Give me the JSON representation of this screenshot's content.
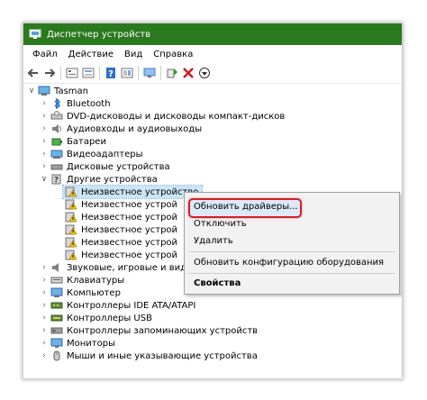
{
  "window": {
    "title": "Диспетчер устройств"
  },
  "menu": [
    "Файл",
    "Действие",
    "Вид",
    "Справка"
  ],
  "toolbar": [
    "back-icon",
    "forward-icon",
    "properties-icon",
    "show-hidden-icon",
    "help-icon",
    "view-icon",
    "monitor-icon",
    "update-driver-icon",
    "uninstall-icon",
    "download-icon"
  ],
  "tree": {
    "root": "Tasman",
    "items": [
      {
        "label": "Bluetooth",
        "icon": "bluetooth-icon"
      },
      {
        "label": "DVD-дисководы и дисководы компакт-дисков",
        "icon": "dvd-drive-icon"
      },
      {
        "label": "Аудиовходы и аудиовыходы",
        "icon": "audio-io-icon"
      },
      {
        "label": "Батареи",
        "icon": "battery-icon"
      },
      {
        "label": "Видеоадаптеры",
        "icon": "display-adapter-icon"
      },
      {
        "label": "Дисковые устройства",
        "icon": "disk-drive-icon"
      },
      {
        "label": "Другие устройства",
        "icon": "other-devices-icon"
      },
      {
        "label": "Звуковые, игровые и вид",
        "icon": "sound-icon"
      },
      {
        "label": "Клавиатуры",
        "icon": "keyboard-icon"
      },
      {
        "label": "Компьютер",
        "icon": "computer-icon"
      },
      {
        "label": "Контроллеры IDE ATA/ATAPI",
        "icon": "ide-controller-icon"
      },
      {
        "label": "Контроллеры USB",
        "icon": "usb-controller-icon"
      },
      {
        "label": "Контроллеры запоминающих устройств",
        "icon": "storage-controller-icon"
      },
      {
        "label": "Мониторы",
        "icon": "monitor-icon"
      },
      {
        "label": "Мыши и иные указывающие устройства",
        "icon": "mouse-icon"
      }
    ],
    "unknown": [
      "Неизвестное устройство",
      "Неизвестное устрой",
      "Неизвестное устрой",
      "Неизвестное устрой",
      "Неизвестное устрой",
      "Неизвестное устрой"
    ]
  },
  "context_menu": {
    "update": "Обновить драйверы...",
    "disable": "Отключить",
    "delete": "Удалить",
    "scan": "Обновить конфигурацию оборудования",
    "properties": "Свойства"
  },
  "colors": {
    "title_bar": "#2b7a1f",
    "highlight_border": "#d0202a",
    "selection": "#cce4f7"
  }
}
